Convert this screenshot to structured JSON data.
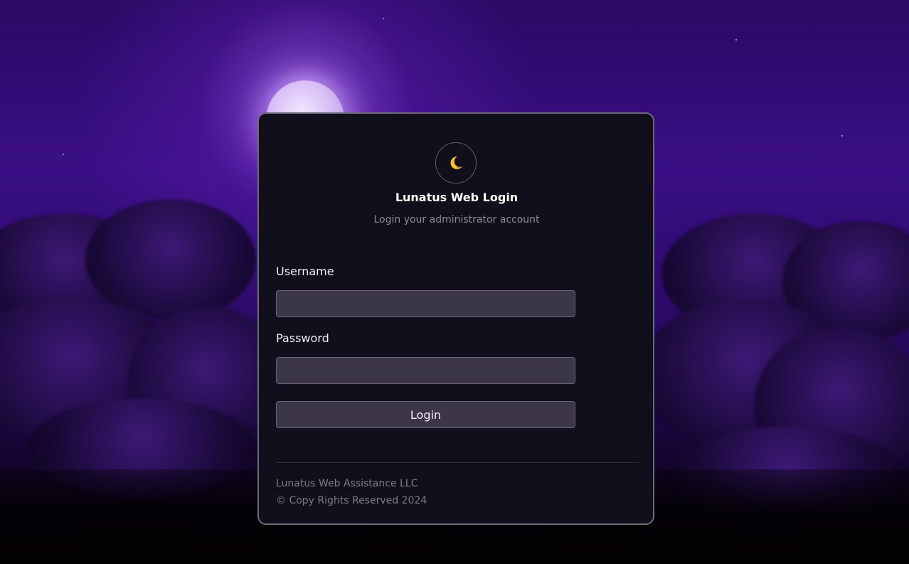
{
  "login": {
    "title": "Lunatus Web Login",
    "subtitle": "Login your administrator account",
    "username_label": "Username",
    "username_value": "",
    "password_label": "Password",
    "password_value": "",
    "submit_label": "Login"
  },
  "footer": {
    "company": "Lunatus Web Assistance LLC",
    "copyright": "© Copy Rights Reserved 2024"
  },
  "icons": {
    "logo": "crescent-moon-icon"
  },
  "colors": {
    "card_background": "#120f1c",
    "input_background": "#3b3749",
    "moon_accent": "#f5c518",
    "sky": "#3a0f86"
  }
}
